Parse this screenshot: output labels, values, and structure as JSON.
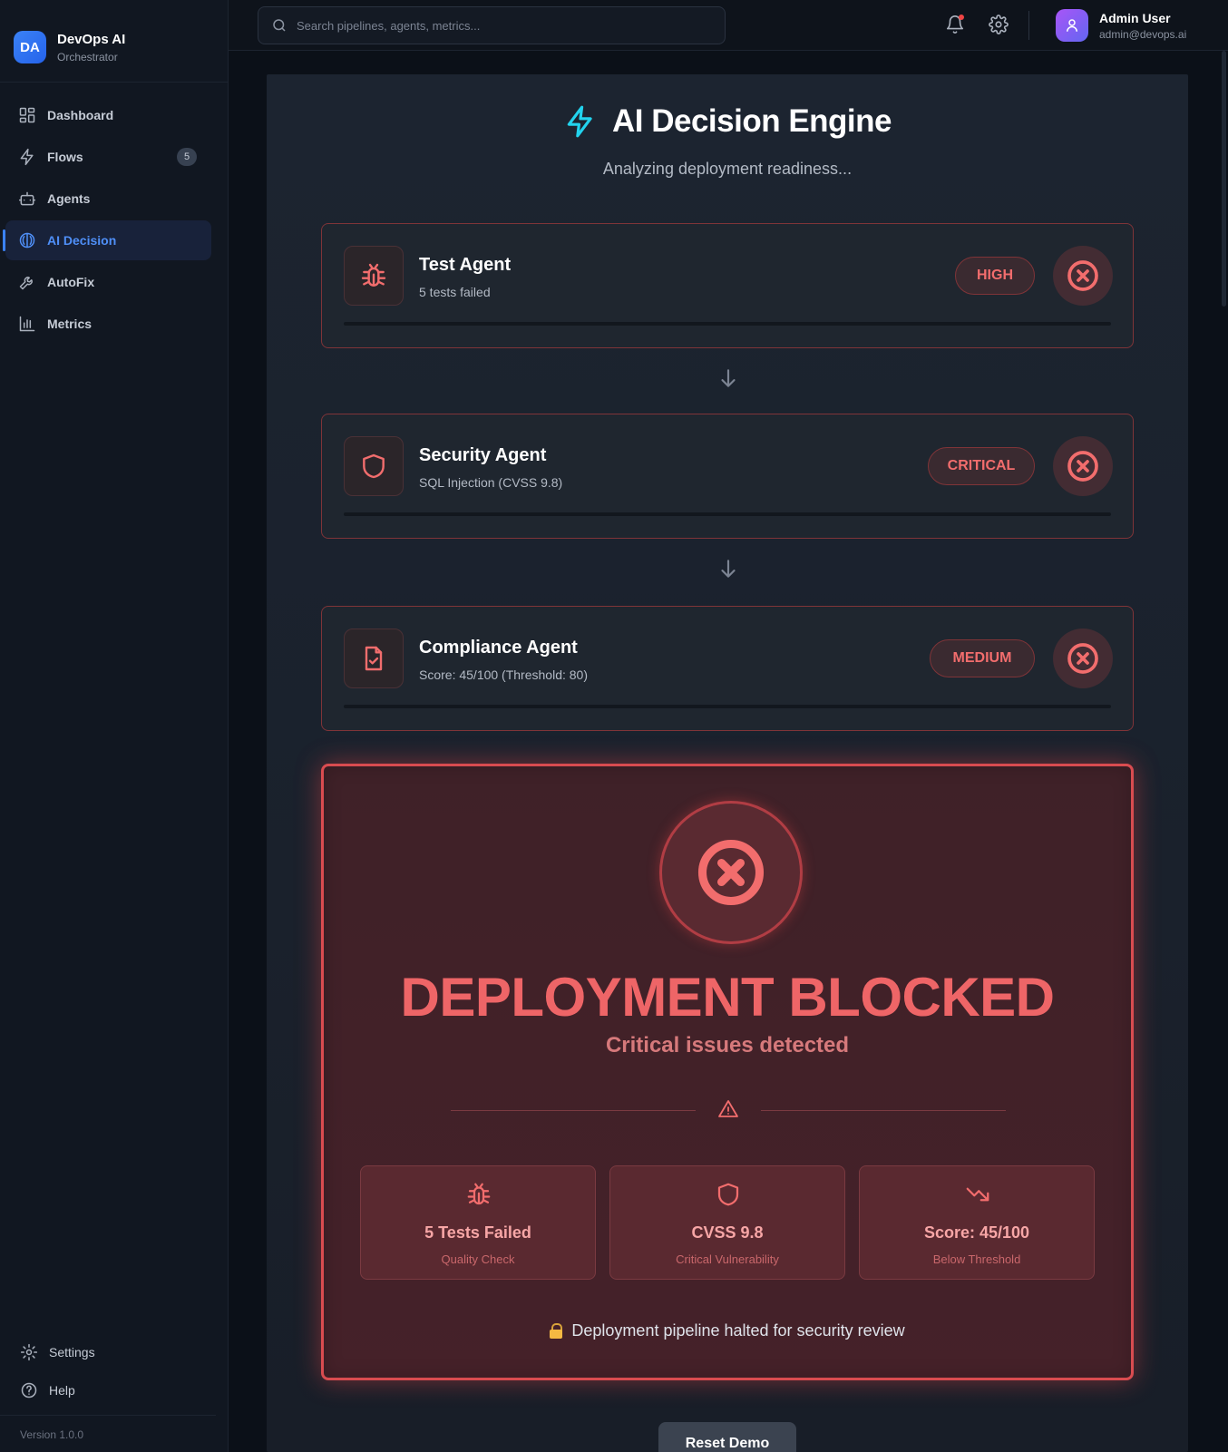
{
  "brand": {
    "logo": "DA",
    "title": "DevOps AI",
    "subtitle": "Orchestrator"
  },
  "sidebar": {
    "items": [
      {
        "label": "Dashboard",
        "icon": "dashboard-icon"
      },
      {
        "label": "Flows",
        "icon": "bolt-icon",
        "badge": "5"
      },
      {
        "label": "Agents",
        "icon": "robot-icon"
      },
      {
        "label": "AI Decision",
        "icon": "brain-icon",
        "active": true
      },
      {
        "label": "AutoFix",
        "icon": "wrench-icon"
      },
      {
        "label": "Metrics",
        "icon": "bar-chart-icon"
      }
    ],
    "bottom": [
      {
        "label": "Settings",
        "icon": "gear-icon"
      },
      {
        "label": "Help",
        "icon": "help-icon"
      }
    ],
    "version": "Version 1.0.0"
  },
  "header": {
    "search_placeholder": "Search pipelines, agents, metrics...",
    "user": {
      "name": "Admin User",
      "email": "admin@devops.ai"
    }
  },
  "engine": {
    "title": "AI Decision Engine",
    "subtitle": "Analyzing deployment readiness..."
  },
  "agents": [
    {
      "name": "Test Agent",
      "detail": "5 tests failed",
      "severity": "HIGH",
      "icon": "bug-icon"
    },
    {
      "name": "Security Agent",
      "detail": "SQL Injection (CVSS 9.8)",
      "severity": "CRITICAL",
      "icon": "shield-icon"
    },
    {
      "name": "Compliance Agent",
      "detail": "Score: 45/100 (Threshold: 80)",
      "severity": "MEDIUM",
      "icon": "file-check-icon"
    }
  ],
  "decision": {
    "title": "DEPLOYMENT BLOCKED",
    "subtitle": "Critical issues detected",
    "stats": [
      {
        "value": "5 Tests Failed",
        "label": "Quality Check",
        "icon": "bug-icon"
      },
      {
        "value": "CVSS 9.8",
        "label": "Critical Vulnerability",
        "icon": "shield-icon"
      },
      {
        "value": "Score: 45/100",
        "label": "Below Threshold",
        "icon": "trending-down-icon"
      }
    ],
    "halt_message": "Deployment pipeline halted for security review"
  },
  "reset_label": "Reset Demo",
  "colors": {
    "accent": "#3b82f6",
    "danger": "#ef4444",
    "cyan": "#22d3ee"
  }
}
